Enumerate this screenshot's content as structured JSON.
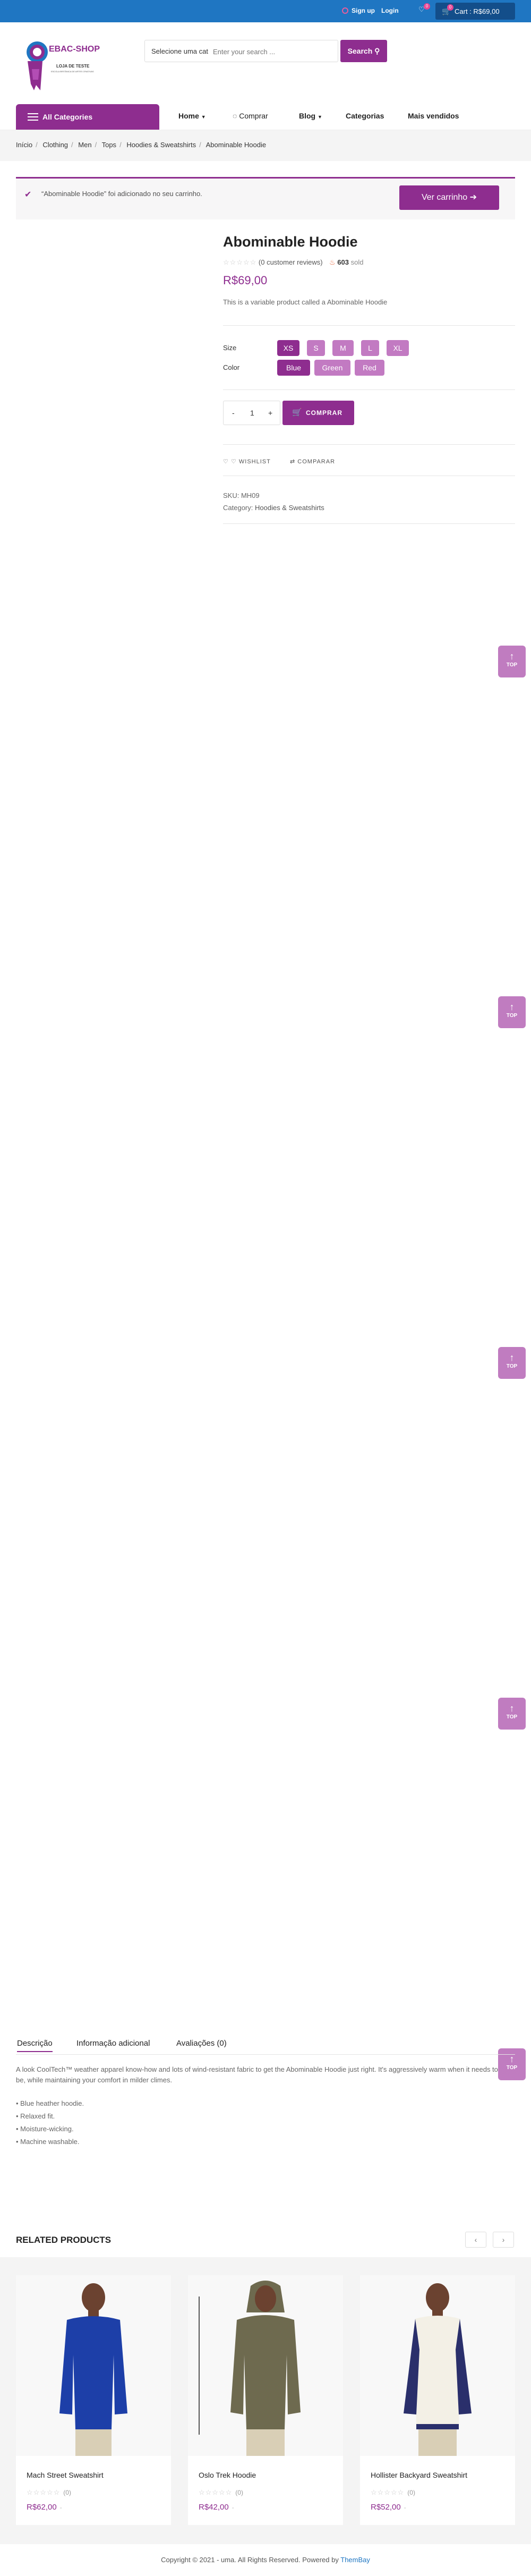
{
  "topbar": {
    "signup": "Sign up",
    "login": "Login",
    "wishlist_count": "0",
    "cart_count": "0",
    "cart": "Cart : R$69,00"
  },
  "header": {
    "logo_title": "EBAC-SHOP",
    "logo_subtitle": "LOJA DE TESTE",
    "logo_tagline": "ESCOLA BRITÂNICA DE ARTES CRIATIVAS",
    "search_category": "Selecione uma cat",
    "search_placeholder": "Enter your search ...",
    "search_button": "Search"
  },
  "nav": {
    "all_categories": "All Categories",
    "items": [
      "Home",
      "Comprar",
      "Blog",
      "Categorias",
      "Mais vendidos"
    ]
  },
  "breadcrumb": [
    "Início",
    "Clothing",
    "Men",
    "Tops",
    "Hoodies & Sweatshirts",
    "Abominable Hoodie"
  ],
  "notice": {
    "message": "“Abominable Hoodie” foi adicionado no seu carrinho.",
    "button": "Ver carrinho"
  },
  "product": {
    "title": "Abominable Hoodie",
    "rating_stars": "☆☆☆☆☆",
    "reviews": "(0 customer reviews)",
    "sold_count": "603",
    "sold_label": "sold",
    "price": "R$69,00",
    "description": "This is a variable product called a Abominable Hoodie",
    "size_label": "Size",
    "sizes": [
      "XS",
      "S",
      "M",
      "L",
      "XL"
    ],
    "color_label": "Color",
    "colors": [
      "Blue",
      "Green",
      "Red"
    ],
    "qty_minus": "-",
    "qty": "1",
    "qty_plus": "+",
    "buy_button": "COMPRAR",
    "wishlist": "WISHLIST",
    "compare": "COMPARAR",
    "sku_label": "SKU:",
    "sku": "MH09",
    "category_label": "Category:",
    "category": "Hoodies & Sweatshirts"
  },
  "top_button": "TOP",
  "tabs": [
    "Descrição",
    "Informação adicional",
    "Avaliações (0)"
  ],
  "long_description": "A look CoolTech™ weather apparel know-how and lots of wind-resistant fabric to get the Abominable Hoodie just right. It's aggressively warm when it needs to be, while maintaining your comfort in milder climes.",
  "bullets": [
    "• Blue heather hoodie.",
    "• Relaxed fit.",
    "• Moisture-wicking.",
    "• Machine washable."
  ],
  "related": {
    "title": "RELATED PRODUCTS",
    "prev": "‹",
    "next": "›",
    "items": [
      {
        "name": "Mach Street Sweatshirt",
        "stars": "☆☆☆☆☆",
        "count": "(0)",
        "price": "R$62,00",
        "old": "-"
      },
      {
        "name": "Oslo Trek Hoodie",
        "stars": "☆☆☆☆☆",
        "count": "(0)",
        "price": "R$42,00",
        "old": "-"
      },
      {
        "name": "Hollister Backyard Sweatshirt",
        "stars": "☆☆☆☆☆",
        "count": "(0)",
        "price": "R$52,00",
        "old": "-"
      }
    ]
  },
  "footer": {
    "copyright": "Copyright © 2021 - uma. All Rights Reserved. Powered by",
    "powered": "ThemBay"
  },
  "colors": {
    "brand": "#8e2d8f",
    "topbar": "#1f76c2",
    "swatch": "#c27ac2"
  }
}
